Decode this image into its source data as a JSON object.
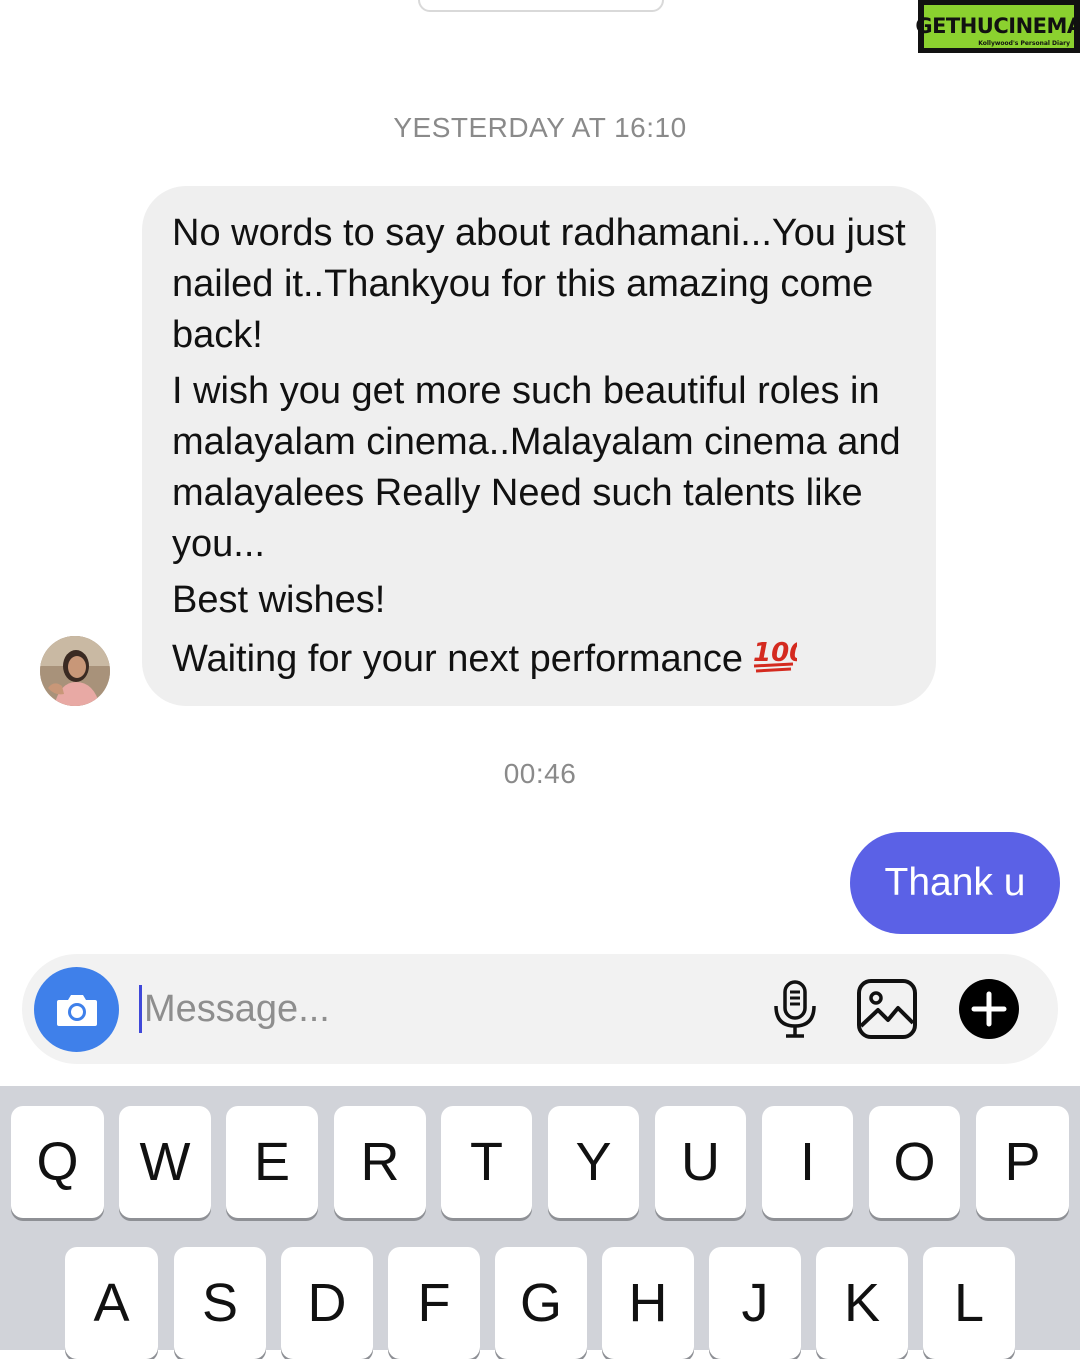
{
  "watermark": {
    "brand": "GETHUCINEMA",
    "tagline": "Kollywood's Personal Diary"
  },
  "conversation": {
    "timestamp_1": "YESTERDAY AT 16:10",
    "incoming_message": {
      "paragraphs": [
        "No words to say about radhamani...You just nailed it..Thankyou for this amazing come back!",
        "I wish you get more such beautiful roles in malayalam cinema..Malayalam cinema and malayalees Really Need such talents like you...",
        "Best wishes!",
        "Waiting for your next performance"
      ],
      "trailing_emoji": "hundred-points-emoji"
    },
    "timestamp_2": "00:46",
    "outgoing_message": "Thank u"
  },
  "composer": {
    "placeholder": "Message...",
    "icons": [
      "camera-icon",
      "microphone-icon",
      "gallery-icon",
      "plus-icon"
    ]
  },
  "keyboard": {
    "row1": [
      "Q",
      "W",
      "E",
      "R",
      "T",
      "Y",
      "U",
      "I",
      "O",
      "P"
    ],
    "row2": [
      "A",
      "S",
      "D",
      "F",
      "G",
      "H",
      "J",
      "K",
      "L"
    ]
  },
  "colors": {
    "outgoing_bubble": "#5b61e6",
    "incoming_bubble": "#efefef",
    "camera_button": "#3f80ea",
    "keyboard_bg": "#d1d3d9",
    "watermark_green": "#8bd12f"
  }
}
